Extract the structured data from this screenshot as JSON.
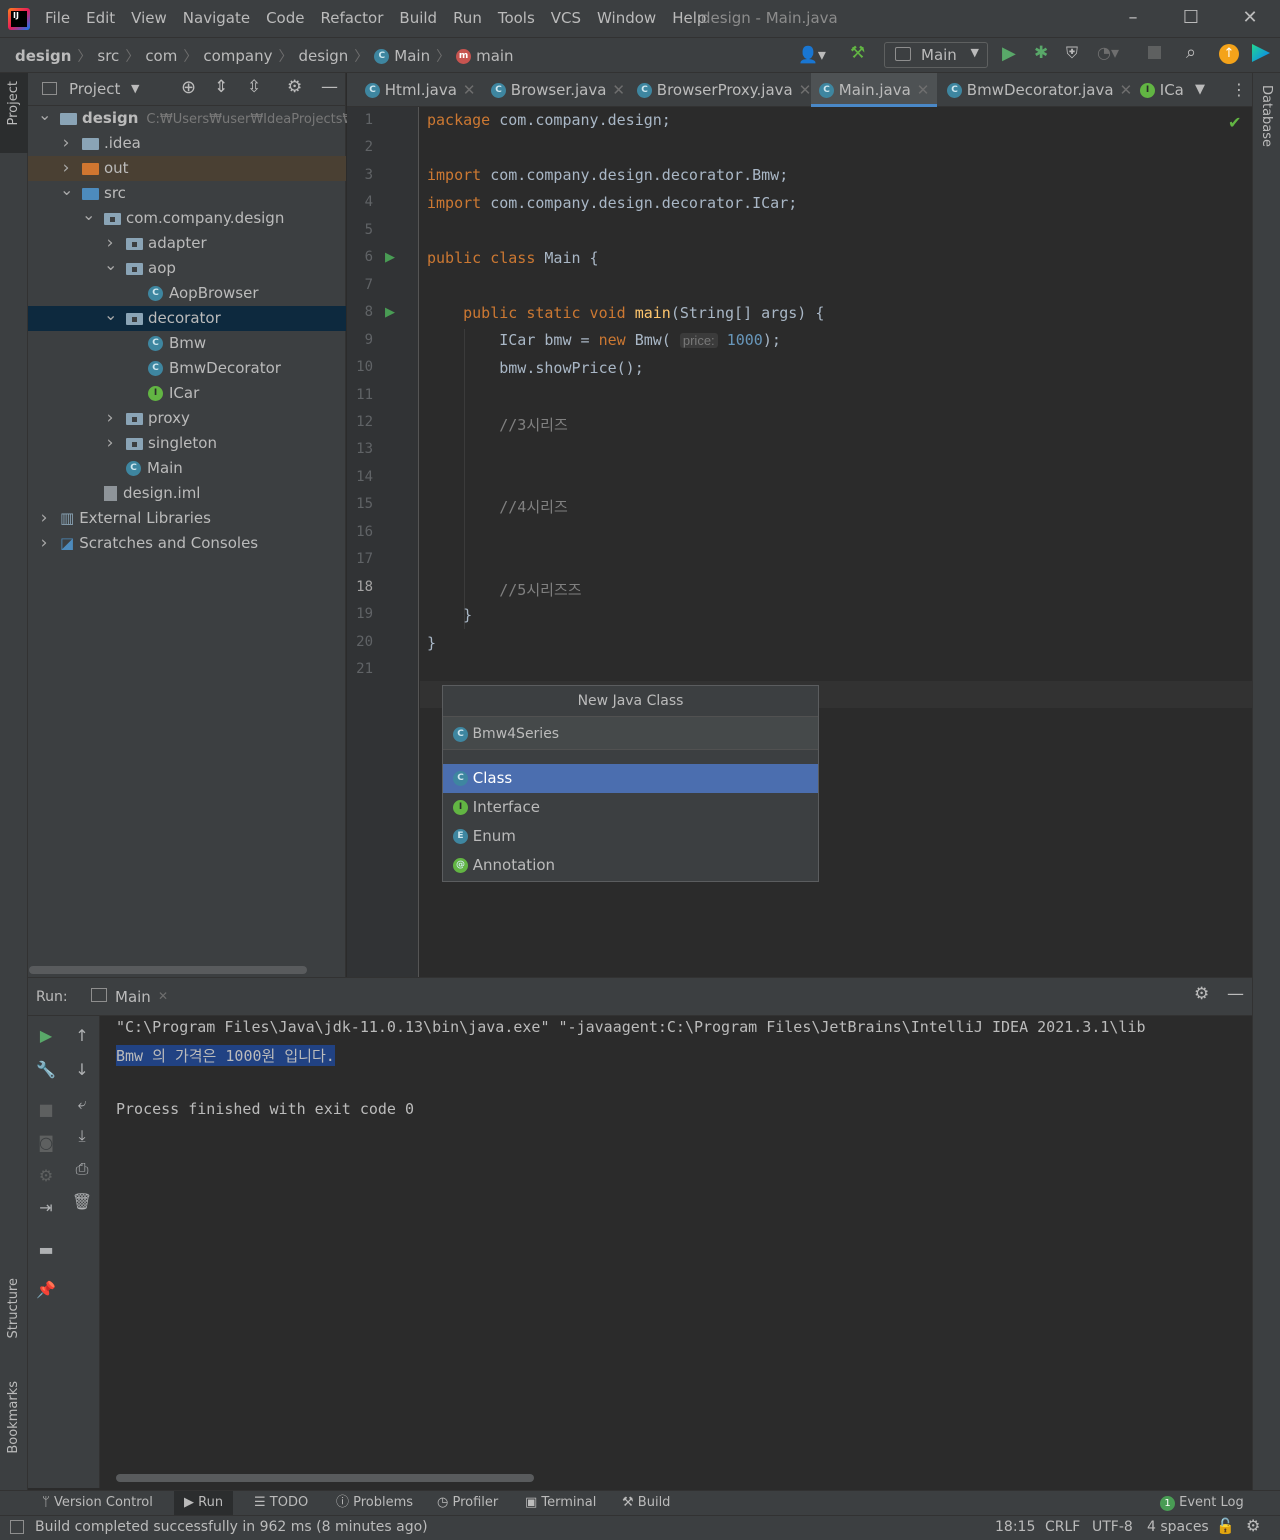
{
  "menu": [
    "File",
    "Edit",
    "View",
    "Navigate",
    "Code",
    "Refactor",
    "Build",
    "Run",
    "Tools",
    "VCS",
    "Window",
    "Help"
  ],
  "window_title": "design - Main.java",
  "breadcrumb": [
    "design",
    "src",
    "com",
    "company",
    "design",
    "Main",
    "main"
  ],
  "run_config": "Main",
  "left_strip": {
    "project": "Project",
    "structure": "Structure",
    "bookmarks": "Bookmarks"
  },
  "right_strip": {
    "database": "Database"
  },
  "project_panel": {
    "title": "Project",
    "tree": [
      {
        "label": "design",
        "path": "C:₩Users₩user₩IdeaProjects₩d",
        "indent": 0,
        "arrow": "down",
        "kind": "module"
      },
      {
        "label": ".idea",
        "indent": 1,
        "arrow": "right",
        "kind": "folder"
      },
      {
        "label": "out",
        "indent": 1,
        "arrow": "right",
        "kind": "out"
      },
      {
        "label": "src",
        "indent": 1,
        "arrow": "down",
        "kind": "src"
      },
      {
        "label": "com.company.design",
        "indent": 2,
        "arrow": "down",
        "kind": "pkg"
      },
      {
        "label": "adapter",
        "indent": 3,
        "arrow": "right",
        "kind": "pkg"
      },
      {
        "label": "aop",
        "indent": 3,
        "arrow": "down",
        "kind": "pkg"
      },
      {
        "label": "AopBrowser",
        "indent": 4,
        "arrow": "",
        "kind": "class"
      },
      {
        "label": "decorator",
        "indent": 3,
        "arrow": "down",
        "kind": "pkg",
        "selected": true
      },
      {
        "label": "Bmw",
        "indent": 4,
        "arrow": "",
        "kind": "class"
      },
      {
        "label": "BmwDecorator",
        "indent": 4,
        "arrow": "",
        "kind": "class"
      },
      {
        "label": "ICar",
        "indent": 4,
        "arrow": "",
        "kind": "interface"
      },
      {
        "label": "proxy",
        "indent": 3,
        "arrow": "right",
        "kind": "pkg"
      },
      {
        "label": "singleton",
        "indent": 3,
        "arrow": "right",
        "kind": "pkg"
      },
      {
        "label": "Main",
        "indent": 3,
        "arrow": "",
        "kind": "mainclass"
      },
      {
        "label": "design.iml",
        "indent": 2,
        "arrow": "",
        "kind": "file"
      },
      {
        "label": "External Libraries",
        "indent": 0,
        "arrow": "right",
        "kind": "libs"
      },
      {
        "label": "Scratches and Consoles",
        "indent": 0,
        "arrow": "right",
        "kind": "scratch"
      }
    ]
  },
  "tabs": [
    {
      "label": "Html.java",
      "active": false
    },
    {
      "label": "Browser.java",
      "active": false
    },
    {
      "label": "BrowserProxy.java",
      "active": false
    },
    {
      "label": "Main.java",
      "active": true
    },
    {
      "label": "BmwDecorator.java",
      "active": false
    },
    {
      "label": "ICa",
      "active": false
    }
  ],
  "code": {
    "line_numbers": [
      "1",
      "2",
      "3",
      "4",
      "5",
      "6",
      "7",
      "8",
      "9",
      "10",
      "11",
      "12",
      "13",
      "14",
      "15",
      "16",
      "17",
      "18",
      "19",
      "20",
      "21"
    ],
    "l1_kw": "package",
    "l1_rest": " com.company.design;",
    "l3_kw": "import",
    "l3_rest": " com.company.design.decorator.Bmw;",
    "l4_kw": "import",
    "l4_rest": " com.company.design.decorator.ICar;",
    "l6_kw": "public class",
    "l6_rest": " Main {",
    "l8_kw": "public static void",
    "l8_fn": "main",
    "l8_rest": "(String[] args) {",
    "l9_a": "ICar bmw = ",
    "l9_kw": "new",
    "l9_b": " Bmw(",
    "l9_hint": "price:",
    "l9_num": "1000",
    "l9_c": ");",
    "l10": "bmw.showPrice();",
    "l12": "//3시리즈",
    "l15": "//4시리즈",
    "l18": "//5시리즈즈",
    "l19": "}",
    "l20": "}"
  },
  "popup": {
    "title": "New Java Class",
    "input": "Bmw4Series",
    "items": [
      {
        "label": "Class",
        "icon": "C"
      },
      {
        "label": "Interface",
        "icon": "I"
      },
      {
        "label": "Enum",
        "icon": "E"
      },
      {
        "label": "Annotation",
        "icon": "@"
      }
    ]
  },
  "run_panel": {
    "label": "Run:",
    "tab": "Main",
    "lines": [
      "\"C:\\Program Files\\Java\\jdk-11.0.13\\bin\\java.exe\" \"-javaagent:C:\\Program Files\\JetBrains\\IntelliJ IDEA 2021.3.1\\lib",
      "Bmw 의 가격은 1000원 입니다.",
      "",
      "Process finished with exit code 0"
    ]
  },
  "bottom_tabs": [
    "Version Control",
    "Run",
    "TODO",
    "Problems",
    "Profiler",
    "Terminal",
    "Build"
  ],
  "event_log": {
    "count": "1",
    "label": "Event Log"
  },
  "status": {
    "message": "Build completed successfully in 962 ms (8 minutes ago)",
    "position": "18:15",
    "line_sep": "CRLF",
    "encoding": "UTF-8",
    "indent": "4 spaces"
  }
}
